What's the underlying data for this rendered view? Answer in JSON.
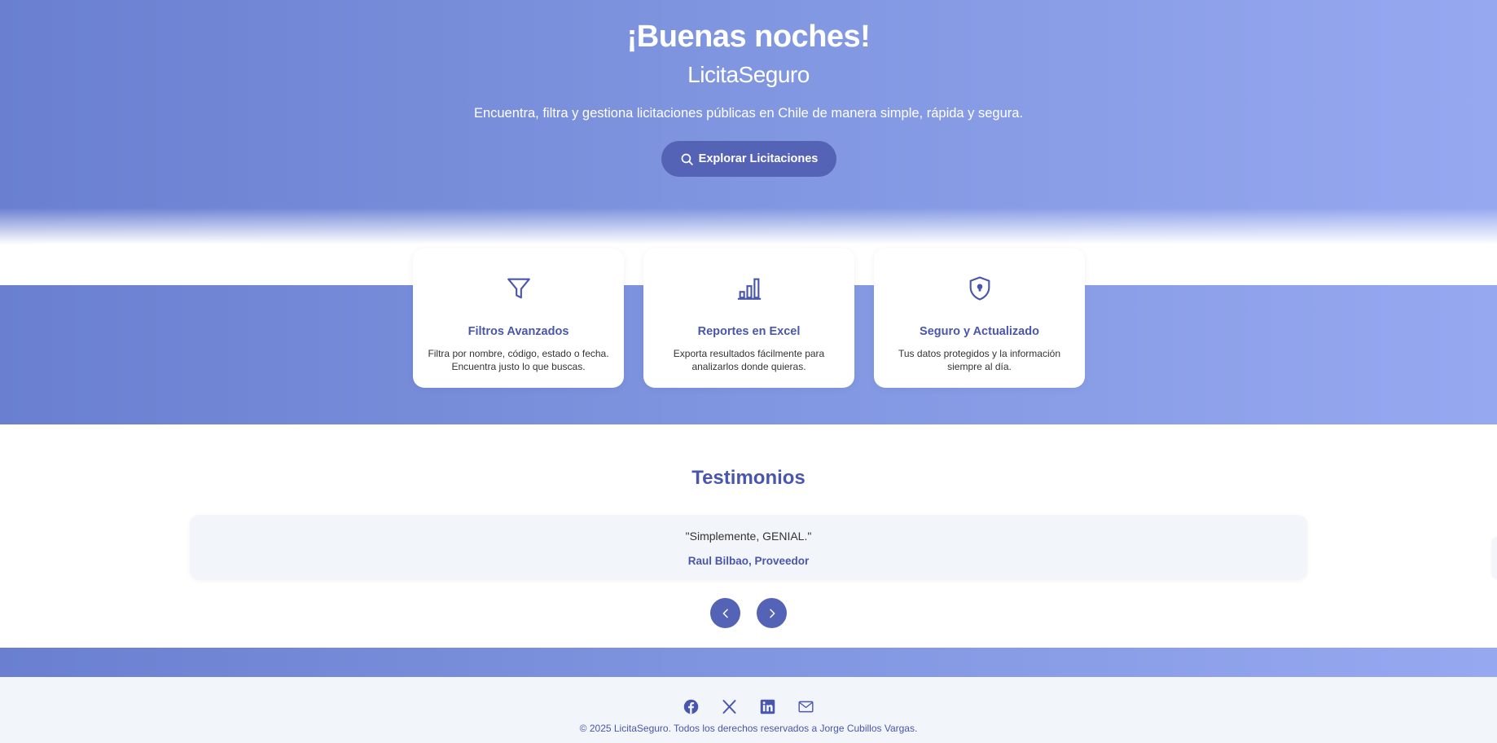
{
  "hero": {
    "greeting": "¡Buenas noches!",
    "brand": "LicitaSeguro",
    "tagline": "Encuentra, filtra y gestiona licitaciones públicas en Chile de manera simple, rápida y segura.",
    "cta_label": "Explorar Licitaciones",
    "cta_icon": "search-icon"
  },
  "features": [
    {
      "icon": "filter-icon",
      "title": "Filtros Avanzados",
      "description": "Filtra por nombre, código, estado o fecha. Encuentra justo lo que buscas."
    },
    {
      "icon": "bar-chart-icon",
      "title": "Reportes en Excel",
      "description": "Exporta resultados fácilmente para analizarlos donde quieras."
    },
    {
      "icon": "shield-lock-icon",
      "title": "Seguro y Actualizado",
      "description": "Tus datos protegidos y la información siempre al día."
    }
  ],
  "testimonials": {
    "title": "Testimonios",
    "quote": "\"Simplemente, GENIAL.\"",
    "author": "Raul Bilbao, Proveedor",
    "prev_icon": "chevron-left-icon",
    "next_icon": "chevron-right-icon"
  },
  "footer": {
    "socials": [
      "facebook-icon",
      "x-icon",
      "linkedin-icon",
      "mail-icon"
    ],
    "copyright": "© 2025 LicitaSeguro. Todos los derechos reservados a Jorge Cubillos Vargas."
  },
  "colors": {
    "accent": "#5563b6",
    "accent_text": "#4a56ad",
    "gradient_start": "#6a7fd0",
    "gradient_end": "#96a8f0",
    "light_bg": "#f2f5fa"
  }
}
